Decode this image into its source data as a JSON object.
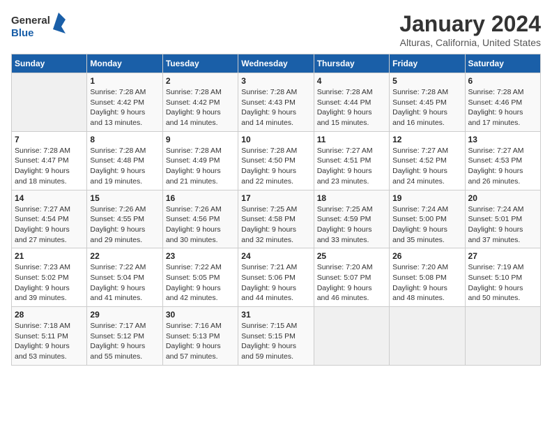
{
  "header": {
    "logo_line1": "General",
    "logo_line2": "Blue",
    "title": "January 2024",
    "subtitle": "Alturas, California, United States"
  },
  "days_of_week": [
    "Sunday",
    "Monday",
    "Tuesday",
    "Wednesday",
    "Thursday",
    "Friday",
    "Saturday"
  ],
  "weeks": [
    [
      {
        "num": "",
        "empty": true
      },
      {
        "num": "1",
        "sunrise": "7:28 AM",
        "sunset": "4:42 PM",
        "daylight": "9 hours and 13 minutes."
      },
      {
        "num": "2",
        "sunrise": "7:28 AM",
        "sunset": "4:42 PM",
        "daylight": "9 hours and 14 minutes."
      },
      {
        "num": "3",
        "sunrise": "7:28 AM",
        "sunset": "4:43 PM",
        "daylight": "9 hours and 14 minutes."
      },
      {
        "num": "4",
        "sunrise": "7:28 AM",
        "sunset": "4:44 PM",
        "daylight": "9 hours and 15 minutes."
      },
      {
        "num": "5",
        "sunrise": "7:28 AM",
        "sunset": "4:45 PM",
        "daylight": "9 hours and 16 minutes."
      },
      {
        "num": "6",
        "sunrise": "7:28 AM",
        "sunset": "4:46 PM",
        "daylight": "9 hours and 17 minutes."
      }
    ],
    [
      {
        "num": "7",
        "sunrise": "7:28 AM",
        "sunset": "4:47 PM",
        "daylight": "9 hours and 18 minutes."
      },
      {
        "num": "8",
        "sunrise": "7:28 AM",
        "sunset": "4:48 PM",
        "daylight": "9 hours and 19 minutes."
      },
      {
        "num": "9",
        "sunrise": "7:28 AM",
        "sunset": "4:49 PM",
        "daylight": "9 hours and 21 minutes."
      },
      {
        "num": "10",
        "sunrise": "7:28 AM",
        "sunset": "4:50 PM",
        "daylight": "9 hours and 22 minutes."
      },
      {
        "num": "11",
        "sunrise": "7:27 AM",
        "sunset": "4:51 PM",
        "daylight": "9 hours and 23 minutes."
      },
      {
        "num": "12",
        "sunrise": "7:27 AM",
        "sunset": "4:52 PM",
        "daylight": "9 hours and 24 minutes."
      },
      {
        "num": "13",
        "sunrise": "7:27 AM",
        "sunset": "4:53 PM",
        "daylight": "9 hours and 26 minutes."
      }
    ],
    [
      {
        "num": "14",
        "sunrise": "7:27 AM",
        "sunset": "4:54 PM",
        "daylight": "9 hours and 27 minutes."
      },
      {
        "num": "15",
        "sunrise": "7:26 AM",
        "sunset": "4:55 PM",
        "daylight": "9 hours and 29 minutes."
      },
      {
        "num": "16",
        "sunrise": "7:26 AM",
        "sunset": "4:56 PM",
        "daylight": "9 hours and 30 minutes."
      },
      {
        "num": "17",
        "sunrise": "7:25 AM",
        "sunset": "4:58 PM",
        "daylight": "9 hours and 32 minutes."
      },
      {
        "num": "18",
        "sunrise": "7:25 AM",
        "sunset": "4:59 PM",
        "daylight": "9 hours and 33 minutes."
      },
      {
        "num": "19",
        "sunrise": "7:24 AM",
        "sunset": "5:00 PM",
        "daylight": "9 hours and 35 minutes."
      },
      {
        "num": "20",
        "sunrise": "7:24 AM",
        "sunset": "5:01 PM",
        "daylight": "9 hours and 37 minutes."
      }
    ],
    [
      {
        "num": "21",
        "sunrise": "7:23 AM",
        "sunset": "5:02 PM",
        "daylight": "9 hours and 39 minutes."
      },
      {
        "num": "22",
        "sunrise": "7:22 AM",
        "sunset": "5:04 PM",
        "daylight": "9 hours and 41 minutes."
      },
      {
        "num": "23",
        "sunrise": "7:22 AM",
        "sunset": "5:05 PM",
        "daylight": "9 hours and 42 minutes."
      },
      {
        "num": "24",
        "sunrise": "7:21 AM",
        "sunset": "5:06 PM",
        "daylight": "9 hours and 44 minutes."
      },
      {
        "num": "25",
        "sunrise": "7:20 AM",
        "sunset": "5:07 PM",
        "daylight": "9 hours and 46 minutes."
      },
      {
        "num": "26",
        "sunrise": "7:20 AM",
        "sunset": "5:08 PM",
        "daylight": "9 hours and 48 minutes."
      },
      {
        "num": "27",
        "sunrise": "7:19 AM",
        "sunset": "5:10 PM",
        "daylight": "9 hours and 50 minutes."
      }
    ],
    [
      {
        "num": "28",
        "sunrise": "7:18 AM",
        "sunset": "5:11 PM",
        "daylight": "9 hours and 53 minutes."
      },
      {
        "num": "29",
        "sunrise": "7:17 AM",
        "sunset": "5:12 PM",
        "daylight": "9 hours and 55 minutes."
      },
      {
        "num": "30",
        "sunrise": "7:16 AM",
        "sunset": "5:13 PM",
        "daylight": "9 hours and 57 minutes."
      },
      {
        "num": "31",
        "sunrise": "7:15 AM",
        "sunset": "5:15 PM",
        "daylight": "9 hours and 59 minutes."
      },
      {
        "num": "",
        "empty": true
      },
      {
        "num": "",
        "empty": true
      },
      {
        "num": "",
        "empty": true
      }
    ]
  ],
  "labels": {
    "sunrise_prefix": "Sunrise: ",
    "sunset_prefix": "Sunset: ",
    "daylight_prefix": "Daylight: "
  }
}
